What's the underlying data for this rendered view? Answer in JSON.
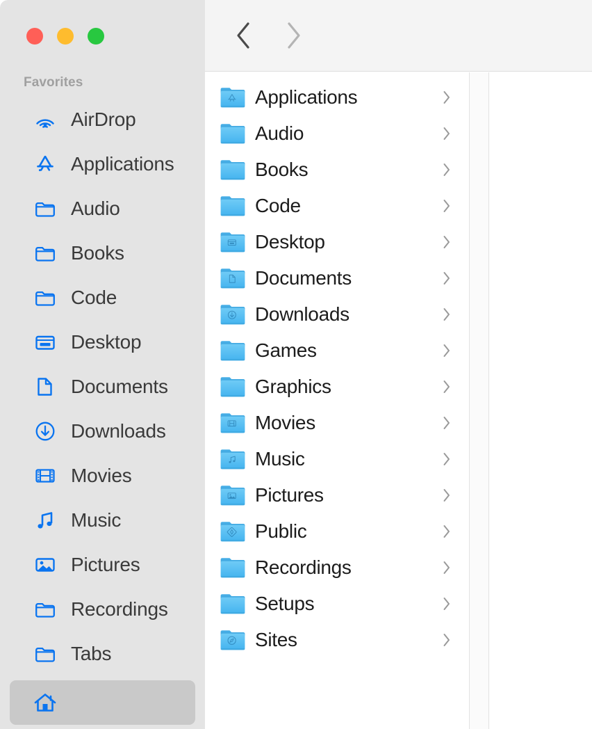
{
  "window": {
    "traffic_lights": [
      {
        "name": "close",
        "color": "#ff5f57"
      },
      {
        "name": "minimize",
        "color": "#febc2e"
      },
      {
        "name": "zoom",
        "color": "#28c840"
      }
    ]
  },
  "toolbar": {
    "back_label": "Back",
    "forward_label": "Forward",
    "back_enabled": true,
    "forward_enabled": false
  },
  "sidebar": {
    "section_title": "Favorites",
    "items": [
      {
        "label": "AirDrop",
        "icon": "airdrop-icon"
      },
      {
        "label": "Applications",
        "icon": "applications-icon"
      },
      {
        "label": "Audio",
        "icon": "folder-icon"
      },
      {
        "label": "Books",
        "icon": "folder-icon"
      },
      {
        "label": "Code",
        "icon": "folder-icon"
      },
      {
        "label": "Desktop",
        "icon": "desktop-icon"
      },
      {
        "label": "Documents",
        "icon": "document-icon"
      },
      {
        "label": "Downloads",
        "icon": "downloads-icon"
      },
      {
        "label": "Movies",
        "icon": "movies-icon"
      },
      {
        "label": "Music",
        "icon": "music-icon"
      },
      {
        "label": "Pictures",
        "icon": "pictures-icon"
      },
      {
        "label": "Recordings",
        "icon": "folder-icon"
      },
      {
        "label": "Tabs",
        "icon": "folder-icon"
      }
    ],
    "selected_item": {
      "label": "",
      "icon": "home-icon",
      "selected": true
    }
  },
  "main": {
    "column_view": true,
    "items": [
      {
        "label": "Applications",
        "icon": "folder-applications",
        "has_children": true
      },
      {
        "label": "Audio",
        "icon": "folder-plain",
        "has_children": true
      },
      {
        "label": "Books",
        "icon": "folder-plain",
        "has_children": true
      },
      {
        "label": "Code",
        "icon": "folder-plain",
        "has_children": true
      },
      {
        "label": "Desktop",
        "icon": "folder-desktop",
        "has_children": true
      },
      {
        "label": "Documents",
        "icon": "folder-documents",
        "has_children": true
      },
      {
        "label": "Downloads",
        "icon": "folder-downloads",
        "has_children": true
      },
      {
        "label": "Games",
        "icon": "folder-plain",
        "has_children": true
      },
      {
        "label": "Graphics",
        "icon": "folder-plain",
        "has_children": true
      },
      {
        "label": "Movies",
        "icon": "folder-movies",
        "has_children": true
      },
      {
        "label": "Music",
        "icon": "folder-music",
        "has_children": true
      },
      {
        "label": "Pictures",
        "icon": "folder-pictures",
        "has_children": true
      },
      {
        "label": "Public",
        "icon": "folder-public",
        "has_children": true
      },
      {
        "label": "Recordings",
        "icon": "folder-plain",
        "has_children": true
      },
      {
        "label": "Setups",
        "icon": "folder-plain",
        "has_children": true
      },
      {
        "label": "Sites",
        "icon": "folder-sites",
        "has_children": true
      }
    ]
  },
  "colors": {
    "accent_blue": "#007aff",
    "folder_blue": "#54bdf4",
    "folder_tab_blue": "#45a9e0",
    "sidebar_bg": "#e4e4e4",
    "toolbar_bg": "#f4f4f4",
    "selection_bg": "#c9c9c9",
    "text_primary": "#1c1c1c",
    "text_sidebar": "#3a3a3a",
    "text_muted": "#a0a0a0"
  }
}
